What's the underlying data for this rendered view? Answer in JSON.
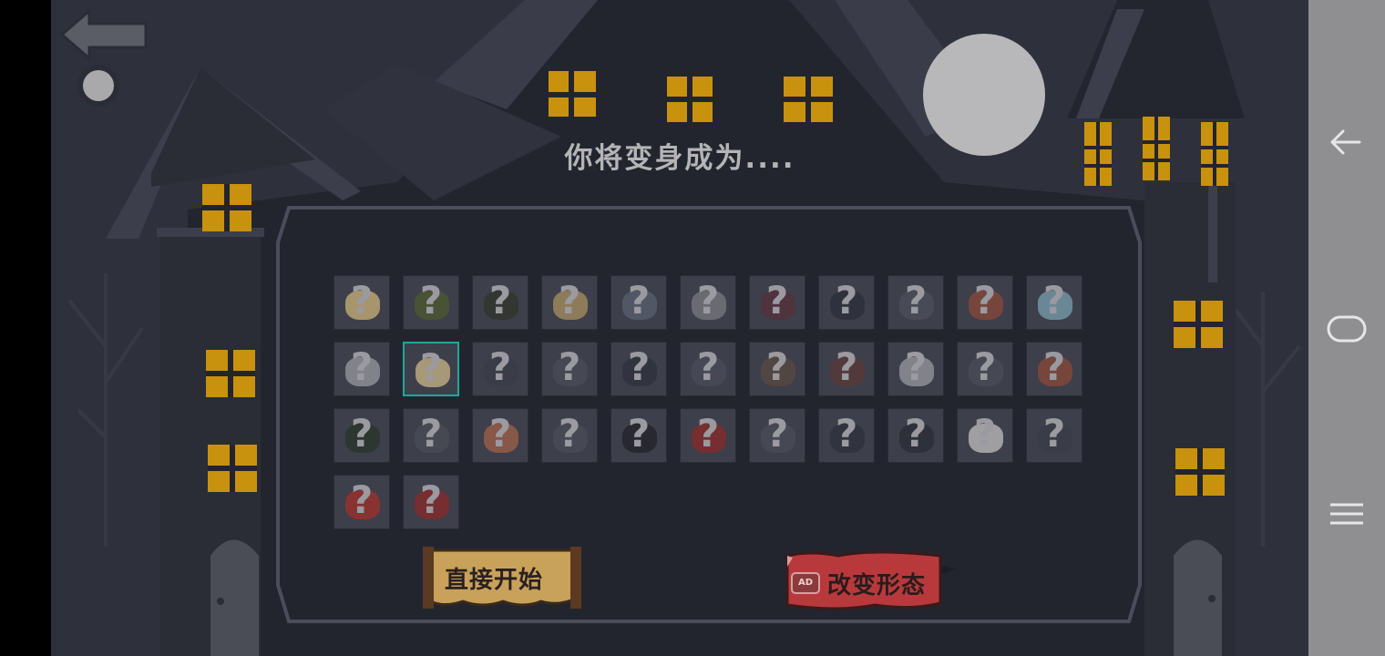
{
  "title": "你将变身成为....",
  "buttons": {
    "start_label": "直接开始",
    "change_label": "改变形态",
    "ad_badge": "AD"
  },
  "grid": {
    "selected_index": 12,
    "items": [
      {
        "symbol": "?",
        "color": "#c9b37a"
      },
      {
        "symbol": "?",
        "color": "#4f5a2f"
      },
      {
        "symbol": "?",
        "color": "#30342a"
      },
      {
        "symbol": "?",
        "color": "#a89060"
      },
      {
        "symbol": "?",
        "color": "#5a6070"
      },
      {
        "symbol": "?",
        "color": "#7a7a80"
      },
      {
        "symbol": "?",
        "color": "#55303a"
      },
      {
        "symbol": "?",
        "color": "#2b2f3a"
      },
      {
        "symbol": "?",
        "color": "#4c505a"
      },
      {
        "symbol": "?",
        "color": "#8a4a3a"
      },
      {
        "symbol": "?",
        "color": "#7aa0b0"
      },
      {
        "symbol": "?",
        "color": "#9a9aa0"
      },
      {
        "symbol": "?",
        "color": "#c9b888"
      },
      {
        "symbol": "?",
        "color": "#3a3e48"
      },
      {
        "symbol": "?",
        "color": "#4a4e58"
      },
      {
        "symbol": "?",
        "color": "#2e323c"
      },
      {
        "symbol": "?",
        "color": "#4a4e5a"
      },
      {
        "symbol": "?",
        "color": "#5a4a40"
      },
      {
        "symbol": "?",
        "color": "#5a3a38"
      },
      {
        "symbol": "?",
        "color": "#9a9aa0"
      },
      {
        "symbol": "?",
        "color": "#4a4e58"
      },
      {
        "symbol": "?",
        "color": "#8a4a3a"
      },
      {
        "symbol": "?",
        "color": "#2a3428"
      },
      {
        "symbol": "?",
        "color": "#4a4e55"
      },
      {
        "symbol": "?",
        "color": "#a06048"
      },
      {
        "symbol": "?",
        "color": "#4a4e58"
      },
      {
        "symbol": "?",
        "color": "#222228"
      },
      {
        "symbol": "?",
        "color": "#8a2a2a"
      },
      {
        "symbol": "?",
        "color": "#4a4e58"
      },
      {
        "symbol": "?",
        "color": "#2e323c"
      },
      {
        "symbol": "?",
        "color": "#2a2e36"
      },
      {
        "symbol": "?",
        "color": "#c0c0c0"
      },
      {
        "symbol": "?",
        "color": "#3a3e48"
      },
      {
        "symbol": "?",
        "color": "#a0302a"
      },
      {
        "symbol": "?",
        "color": "#8a2a2a"
      }
    ]
  },
  "icons": {
    "back": "back-arrow-icon",
    "moon": "moon-icon",
    "nav_back": "nav-back-icon",
    "nav_home": "nav-home-icon",
    "nav_menu": "nav-menu-icon"
  },
  "colors": {
    "window": "#c8920e",
    "select_border": "#1fa79a",
    "start_button": "#c8a25a",
    "change_button": "#b8393c"
  }
}
